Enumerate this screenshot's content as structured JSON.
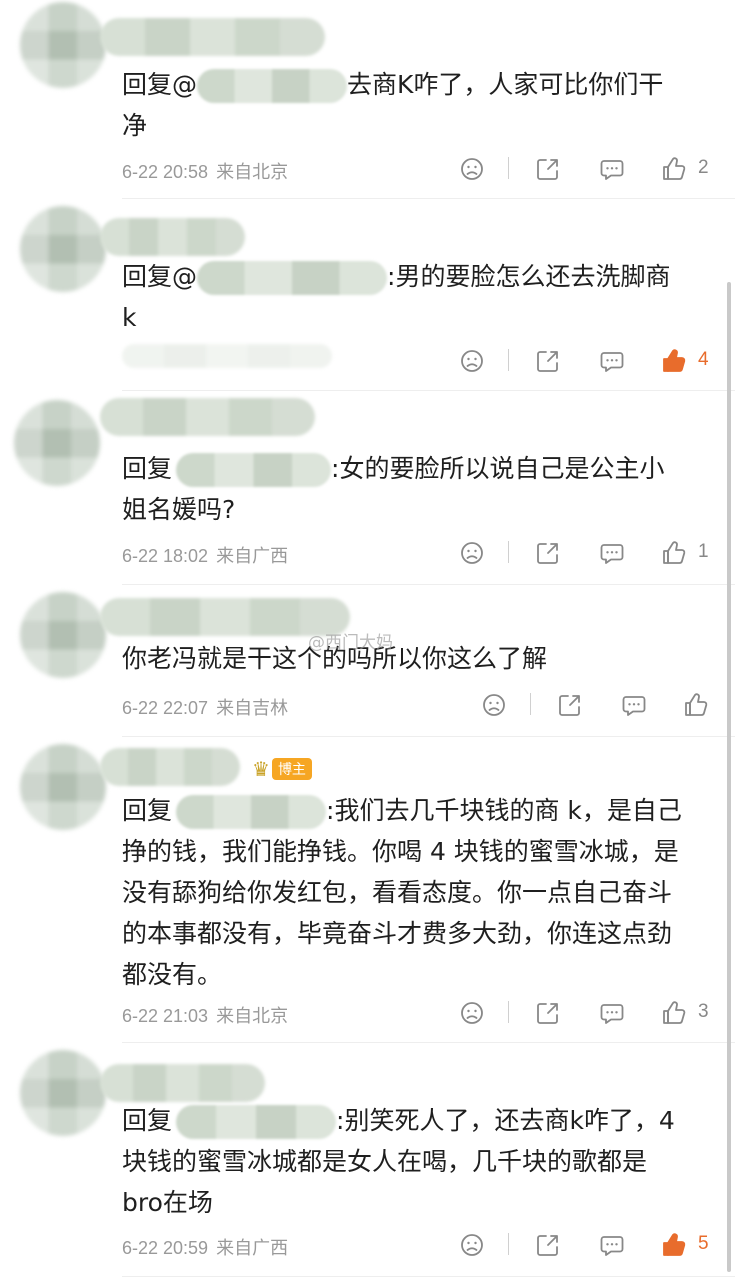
{
  "comments": [
    {
      "prefix": "回复",
      "mention": "@",
      "text_line1": "去商K咋了，人家可比你们干",
      "text_line2": "净",
      "time": "6-22 20:58",
      "location": "来自北京",
      "likes": "2",
      "liked": false
    },
    {
      "prefix": "回复",
      "mention": "@",
      "text_line1": ":男的要脸怎么还去洗脚商",
      "text_line2": "k",
      "time": "",
      "location": "",
      "likes": "4",
      "liked": true
    },
    {
      "prefix": "回复",
      "text_line1": ":女的要脸所以说自己是公主小",
      "text_line2": "姐名媛吗?",
      "time": "6-22 18:02",
      "location": "来自广西",
      "likes": "1",
      "liked": false
    },
    {
      "text_line1": "你老冯就是干这个的吗所以你这么了解",
      "time": "6-22 22:07",
      "location": "来自吉林",
      "likes": "",
      "liked": false
    },
    {
      "badge": "博主",
      "prefix": "回复",
      "text_line1": ":我们去几千块钱的商 k，是自己",
      "text_line2": "挣的钱，我们能挣钱。你喝 4 块钱的蜜雪冰城，是",
      "text_line3": "没有舔狗给你发红包，看看态度。你一点自己奋斗",
      "text_line4": "的本事都没有，毕竟奋斗才费多大劲，你连这点劲",
      "text_line5": "都没有。",
      "time": "6-22 21:03",
      "location": "来自北京",
      "likes": "3",
      "liked": false
    },
    {
      "prefix": "回复",
      "text_line1": ":别笑死人了，还去商k咋了，4",
      "text_line2": "块钱的蜜雪冰城都是女人在喝，几千块的歌都是",
      "text_line3": "bro在场",
      "time": "6-22 20:59",
      "location": "来自广西",
      "likes": "5",
      "liked": true
    }
  ],
  "watermark": "@西门大妈",
  "colors": {
    "like_active": "#e86c2c",
    "meta": "#999999",
    "text": "#1f1f1f"
  },
  "icons": [
    "dislike-icon",
    "repost-icon",
    "comment-icon",
    "like-icon",
    "crown-icon"
  ]
}
